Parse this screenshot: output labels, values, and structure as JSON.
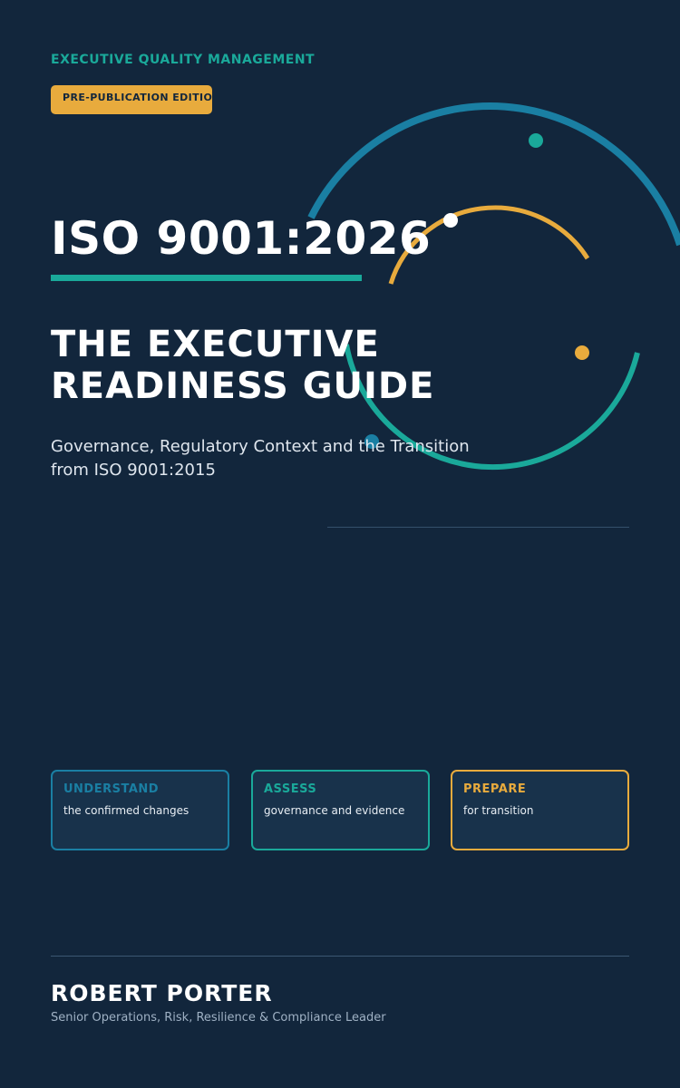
{
  "colors": {
    "background": "#12263c",
    "teal": "#1aa99a",
    "blue": "#1a7fa3",
    "amber": "#e8ab3d",
    "text": "#ffffff"
  },
  "cover": {
    "kicker": "EXECUTIVE QUALITY MANAGEMENT",
    "badge": "PRE-PUBLICATION EDITION",
    "main_title": "ISO 9001:2026",
    "subtitle_lines": [
      "THE EXECUTIVE",
      "READINESS GUIDE"
    ],
    "tagline_lines": [
      "Governance, Regulatory Context and the Transition",
      "from ISO 9001:2015"
    ]
  },
  "pillars": [
    {
      "heading": "UNDERSTAND",
      "text": "the confirmed changes",
      "color": "#1a7fa3"
    },
    {
      "heading": "ASSESS",
      "text": "governance and evidence",
      "color": "#1aa99a"
    },
    {
      "heading": "PREPARE",
      "text": "for transition",
      "color": "#e8ab3d"
    }
  ],
  "author": {
    "name": "ROBERT PORTER",
    "role": "Senior Operations, Risk, Resilience & Compliance Leader"
  }
}
